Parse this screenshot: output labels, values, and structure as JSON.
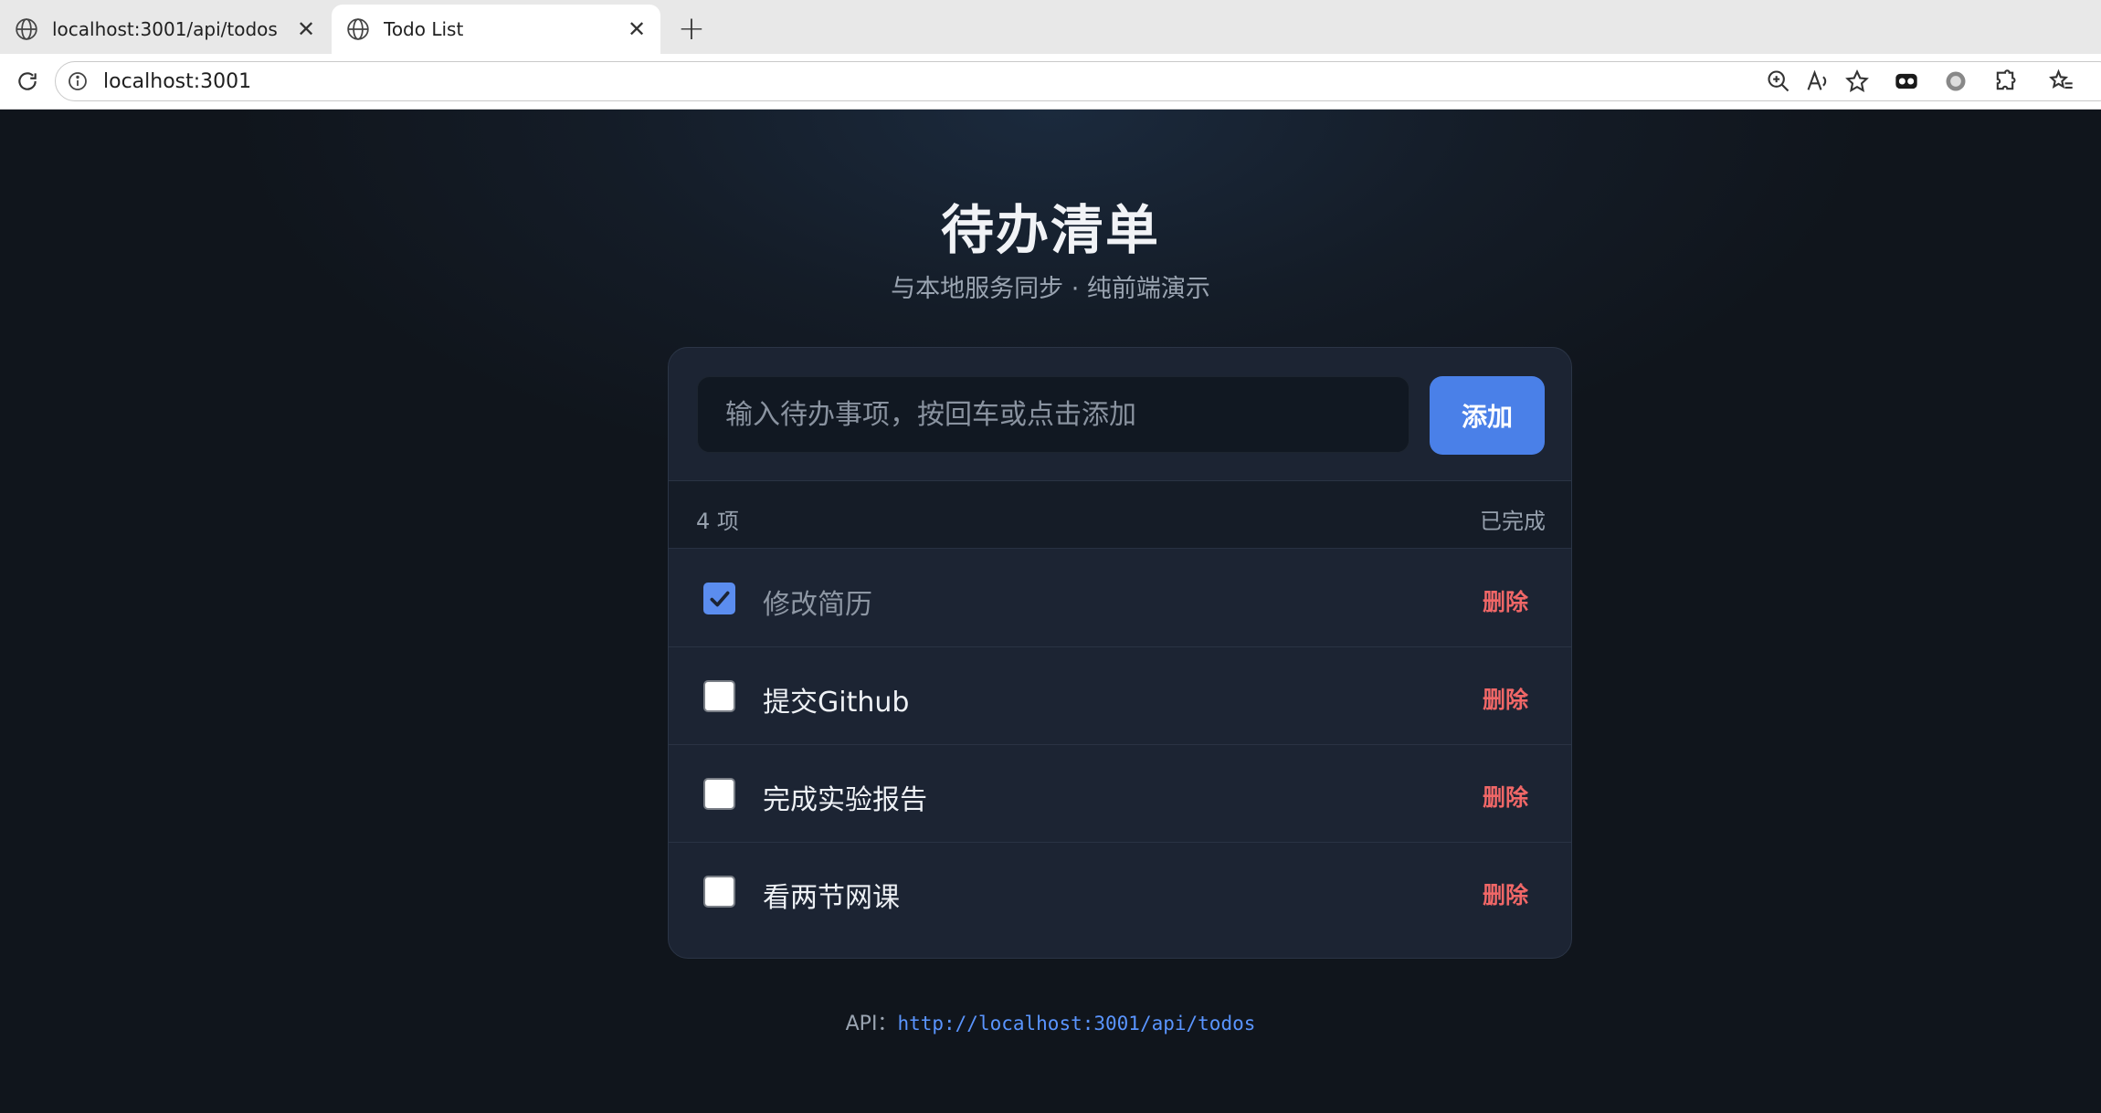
{
  "browser": {
    "tabs": [
      {
        "title": "localhost:3001/api/todos",
        "active": false
      },
      {
        "title": "Todo List",
        "active": true
      }
    ],
    "url": "localhost:3001"
  },
  "page": {
    "title": "待办清单",
    "subtitle": "与本地服务同步 · 纯前端演示",
    "input_placeholder": "输入待办事项，按回车或点击添加",
    "add_label": "添加",
    "count_label": "4 项",
    "filter_label": "已完成",
    "todos": [
      {
        "text": "修改简历",
        "done": true,
        "delete_label": "删除"
      },
      {
        "text": "提交Github",
        "done": false,
        "delete_label": "删除"
      },
      {
        "text": "完成实验报告",
        "done": false,
        "delete_label": "删除"
      },
      {
        "text": "看两节网课",
        "done": false,
        "delete_label": "删除"
      }
    ],
    "api_label": "API：",
    "api_url": "http://localhost:3001/api/todos"
  },
  "colors": {
    "accent": "#4a80e8",
    "delete": "#f06767",
    "background": "#10151c",
    "card": "#1c2433"
  }
}
